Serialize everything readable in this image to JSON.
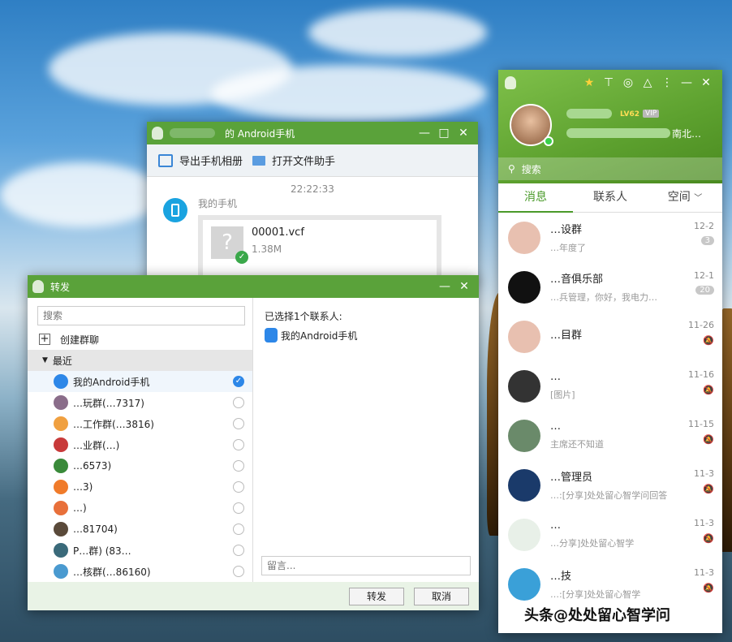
{
  "desktop": {
    "icon": "wallpaper"
  },
  "chat_window": {
    "title_suffix": "的 Android手机",
    "toolbar": {
      "export_label": "导出手机相册",
      "open_label": "打开文件助手"
    },
    "timestamp": "22:22:33",
    "sender": "我的手机",
    "file": {
      "name": "00001.vcf",
      "size": "1.38M"
    }
  },
  "forward_dialog": {
    "title": "转发",
    "search_placeholder": "搜索",
    "create_group": "创建群聊",
    "recent_label": "最近",
    "selected_header": "已选择1个联系人:",
    "selected_contact": "我的Android手机",
    "message_placeholder": "留言...",
    "forward_button": "转发",
    "cancel_button": "取消",
    "items": [
      {
        "label": "我的Android手机",
        "selected": true,
        "color": "#2d87e8"
      },
      {
        "label": "…玩群(…7317)",
        "selected": false,
        "color": "#8a6d8a"
      },
      {
        "label": "…工作群(…3816)",
        "selected": false,
        "color": "#f0a040"
      },
      {
        "label": "…业群(…)",
        "selected": false,
        "color": "#c83a3a"
      },
      {
        "label": "…6573)",
        "selected": false,
        "color": "#3a8a3a"
      },
      {
        "label": "…3)",
        "selected": false,
        "color": "#f07b2a"
      },
      {
        "label": "…)",
        "selected": false,
        "color": "#e8703a"
      },
      {
        "label": "…81704)",
        "selected": false,
        "color": "#5a4a3a"
      },
      {
        "label": "P…群) (83…",
        "selected": false,
        "color": "#3a6a7a"
      },
      {
        "label": "…核群(…86160)",
        "selected": false,
        "color": "#4a9ad0"
      }
    ]
  },
  "qq_panel": {
    "level_badge": "LV62",
    "vip_badge": "VIP",
    "location": "南北…",
    "search_placeholder": "搜索",
    "tabs": [
      {
        "label": "消息",
        "active": true
      },
      {
        "label": "联系人",
        "active": false
      },
      {
        "label": "空间",
        "active": false
      }
    ],
    "tab_arrow": "﹀",
    "conversations": [
      {
        "name": "…设群",
        "preview": "…年度了",
        "time": "12-2",
        "badge": "3",
        "avatar": "#e8c0b0"
      },
      {
        "name": "…音俱乐部",
        "preview": "…兵管理，你好，我电力…",
        "time": "12-1",
        "badge": "20",
        "avatar": "#111"
      },
      {
        "name": "…目群",
        "preview": "",
        "time": "11-26",
        "badge": "",
        "avatar": "#e8c0b0"
      },
      {
        "name": "…",
        "preview": "[图片]",
        "time": "11-16",
        "badge": "",
        "avatar": "#333"
      },
      {
        "name": "…",
        "preview": "主席还不知道",
        "time": "11-15",
        "badge": "",
        "avatar": "#6a8a6a"
      },
      {
        "name": "…管理员",
        "preview": "…:[分享]处处留心智学问回答",
        "time": "11-3",
        "badge": "",
        "avatar": "#1a3a6a"
      },
      {
        "name": "…",
        "preview": "…分享]处处留心智学",
        "time": "11-3",
        "badge": "",
        "avatar": "#e8f0e8"
      },
      {
        "name": "…技",
        "preview": "…:[分享]处处留心智学",
        "time": "11-3",
        "badge": "",
        "avatar": "#3aa0d8"
      }
    ],
    "watermark": "头条@处处留心智学问"
  }
}
